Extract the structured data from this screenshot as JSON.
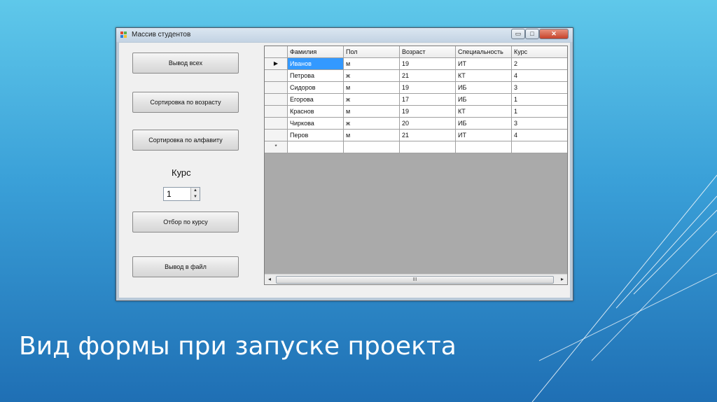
{
  "window": {
    "title": "Массив студентов",
    "controls": {
      "minimize": "▭",
      "maximize": "□",
      "close": "✕"
    }
  },
  "buttons": {
    "show_all": "Вывод всех",
    "sort_age": "Сортировка по возрасту",
    "sort_alpha": "Сортировка по алфавиту",
    "filter_course": "Отбор по курсу",
    "export_file": "Вывод в файл"
  },
  "course": {
    "label": "Курс",
    "value": "1",
    "up": "▲",
    "down": "▼"
  },
  "grid": {
    "columns": [
      "Фамилия",
      "Пол",
      "Возраст",
      "Специальность",
      "Курс"
    ],
    "rows": [
      [
        "Иванов",
        "м",
        "19",
        "ИТ",
        "2"
      ],
      [
        "Петрова",
        "ж",
        "21",
        "КТ",
        "4"
      ],
      [
        "Сидоров",
        "м",
        "19",
        "ИБ",
        "3"
      ],
      [
        "Егорова",
        "ж",
        "17",
        "ИБ",
        "1"
      ],
      [
        "Краснов",
        "м",
        "19",
        "КТ",
        "1"
      ],
      [
        "Чиркова",
        "ж",
        "20",
        "ИБ",
        "3"
      ],
      [
        "Перов",
        "м",
        "21",
        "ИТ",
        "4"
      ]
    ],
    "current_row_marker": "▶",
    "new_row_marker": "*",
    "scroll": {
      "left": "◂",
      "right": "▸",
      "thumb": "III"
    }
  },
  "slide_title": "Вид формы при запуске проекта",
  "colors": {
    "selected": "#3399ff",
    "grid_bg": "#aaaaaa",
    "background_top": "#5fc8ea",
    "background_bottom": "#1f6fb4"
  }
}
